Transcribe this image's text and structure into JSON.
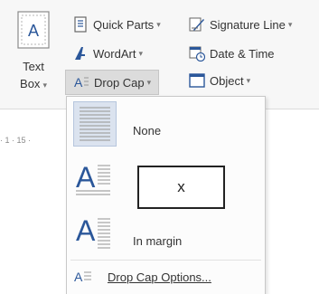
{
  "ribbon": {
    "text_box": {
      "line1": "Text",
      "line2": "Box",
      "caret": "▾"
    },
    "quick_parts": {
      "label": "Quick Parts",
      "caret": "▾"
    },
    "wordart": {
      "label": "WordArt",
      "caret": "▾"
    },
    "drop_cap": {
      "label": "Drop Cap",
      "caret": "▾"
    },
    "signature_line": {
      "label": "Signature Line",
      "caret": "▾"
    },
    "date_time": {
      "label": "Date & Time"
    },
    "object": {
      "label": "Object",
      "caret": "▾"
    }
  },
  "ruler": {
    "text": "· 1 · 15 ·"
  },
  "drop_cap_menu": {
    "items": [
      {
        "label": "None"
      },
      {
        "label": "x"
      },
      {
        "label": "In margin"
      }
    ],
    "options_label": "Drop Cap Options..."
  },
  "colors": {
    "selected_bg": "#dbe3ef",
    "icon_blue": "#2b579a"
  }
}
